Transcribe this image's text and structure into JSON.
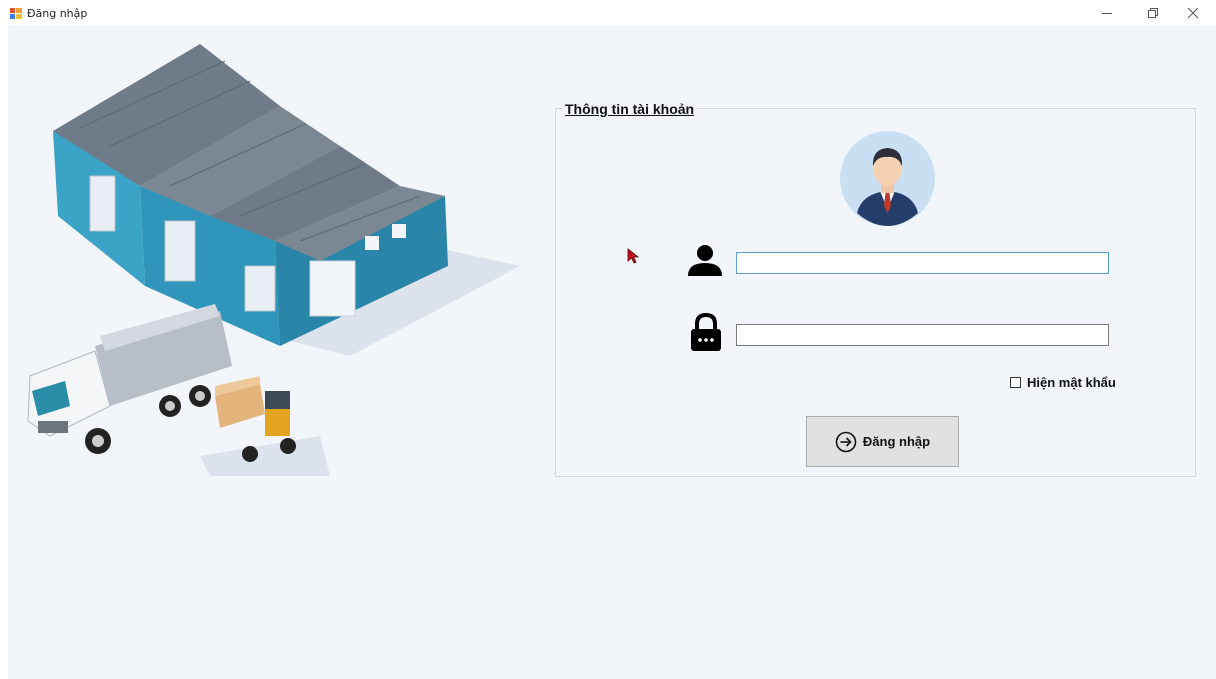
{
  "window": {
    "title": "Đăng nhập",
    "controls": [
      "minimize-icon",
      "restore-icon",
      "close-icon"
    ]
  },
  "account_group": {
    "title": "Thông tin tài khoản",
    "username": {
      "value": "",
      "placeholder": ""
    },
    "password": {
      "value": "",
      "placeholder": ""
    },
    "show_password": {
      "label": "Hiện mật khẩu",
      "checked": false
    },
    "login_button": {
      "label": "Đăng nhập",
      "icon": "arrow-right-circle-icon"
    }
  },
  "colors": {
    "background": "#f2f5f9",
    "input_focus_border": "#5b9bd5",
    "button_bg": "#e1e1e1"
  }
}
